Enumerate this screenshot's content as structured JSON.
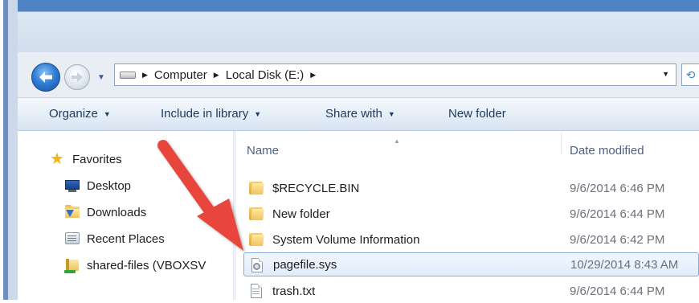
{
  "window": {
    "nav": {
      "back_icon": "back-arrow-icon",
      "forward_icon": "forward-arrow-icon",
      "history_icon": "chevron-down-icon"
    },
    "address": {
      "drive_icon": "drive-icon",
      "crumbs": [
        "Computer",
        "Local Disk (E:)"
      ],
      "dropdown_icon": "chevron-down-icon",
      "refresh_icon": "refresh-icon"
    }
  },
  "toolbar": {
    "organize": "Organize",
    "include": "Include in library",
    "share": "Share with",
    "new_folder": "New folder"
  },
  "sidebar": {
    "favorites": "Favorites",
    "items": [
      {
        "label": "Desktop",
        "icon": "desktop-icon"
      },
      {
        "label": "Downloads",
        "icon": "downloads-icon"
      },
      {
        "label": "Recent Places",
        "icon": "recent-places-icon"
      },
      {
        "label": "shared-files (VBOXSV",
        "icon": "shared-folder-icon"
      }
    ]
  },
  "columns": {
    "name": "Name",
    "date": "Date modified"
  },
  "files": [
    {
      "name": "$RECYCLE.BIN",
      "date": "9/6/2014 6:46 PM",
      "icon": "folder-icon"
    },
    {
      "name": "New folder",
      "date": "9/6/2014 6:44 PM",
      "icon": "folder-icon"
    },
    {
      "name": "System Volume Information",
      "date": "9/6/2014 6:42 PM",
      "icon": "folder-icon"
    },
    {
      "name": "pagefile.sys",
      "date": "10/29/2014 8:43 AM",
      "icon": "system-file-icon",
      "selected": true
    },
    {
      "name": "trash.txt",
      "date": "9/6/2014 6:44 PM",
      "icon": "text-file-icon"
    }
  ],
  "colors": {
    "annotation_arrow": "#e8453c",
    "selection_border": "#84acdd",
    "toolbar_text": "#1e3a5c",
    "header_text": "#4d6185"
  }
}
